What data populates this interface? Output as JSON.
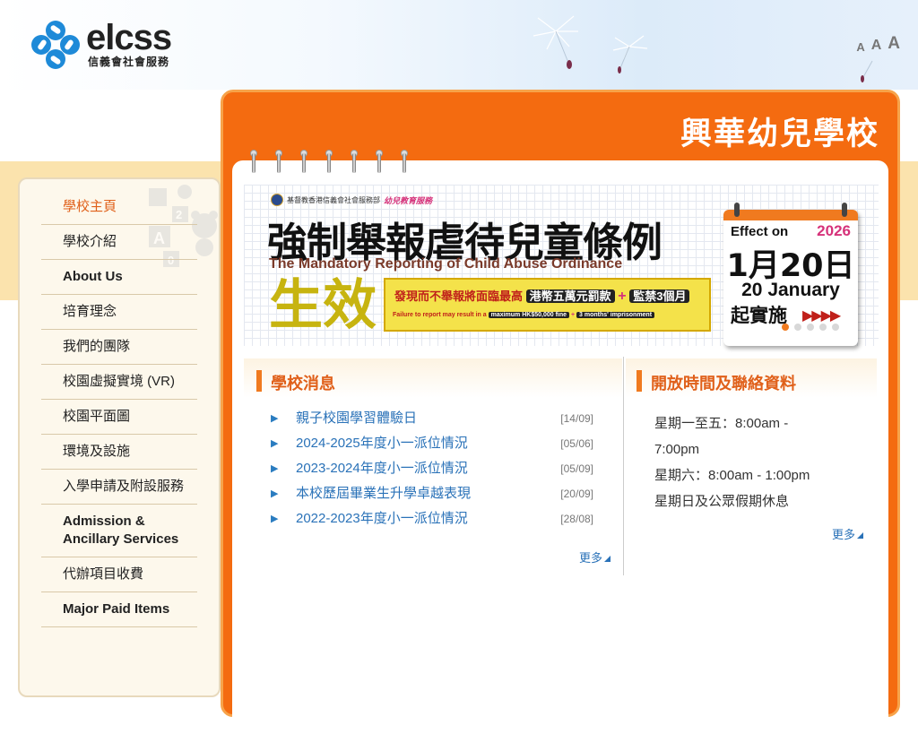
{
  "logo": {
    "brand": "elcss",
    "sub": "信義會社會服務"
  },
  "font_size_controls": [
    "A",
    "A",
    "A"
  ],
  "school_title": "興華幼兒學校",
  "banner": {
    "org": "基督教香港信義會社會服務部",
    "service": "幼兒教育服務",
    "headline_zh": "強制舉報虐待兒童條例",
    "headline_en": "The Mandatory Reporting of Child Abuse Ordinance",
    "effective_zh": "生效",
    "penalty_zh_a": "發現而不舉報將面臨最高",
    "penalty_zh_fine": "港幣五萬元罰款",
    "penalty_zh_plus": "+",
    "penalty_zh_jail": "監禁3個月",
    "penalty_en_a": "Failure to report may result in a",
    "penalty_en_fine": "maximum HK$50,000 fine",
    "penalty_en_plus": "+",
    "penalty_en_jail": "3 months' imprisonment",
    "calendar": {
      "effect_on": "Effect on",
      "year": "2026",
      "date_zh": "1月20日",
      "date_en": "20 January",
      "start_zh": "起實施",
      "arrows": "▶▶▶▶"
    },
    "slide_count": 5,
    "active_slide": 1
  },
  "sidebar": {
    "items": [
      {
        "label": "學校主頁",
        "active": true
      },
      {
        "label": "學校介紹"
      },
      {
        "label": "About Us"
      },
      {
        "label": "培育理念"
      },
      {
        "label": "我們的團隊"
      },
      {
        "label": "校園虛擬實境 (VR)"
      },
      {
        "label": "校園平面圖"
      },
      {
        "label": "環境及設施"
      },
      {
        "label": "入學申請及附設服務"
      },
      {
        "label": "Admission & Ancillary Services"
      },
      {
        "label": "代辦項目收費"
      },
      {
        "label": "Major Paid Items"
      }
    ]
  },
  "news": {
    "title": "學校消息",
    "items": [
      {
        "title": "親子校園學習體驗日",
        "date": "[14/09]"
      },
      {
        "title": "2024-2025年度小一派位情況",
        "date": "[05/06]"
      },
      {
        "title": "2023-2024年度小一派位情況",
        "date": "[05/09]"
      },
      {
        "title": "本校歷屆畢業生升學卓越表現",
        "date": "[20/09]"
      },
      {
        "title": "2022-2023年度小一派位情況",
        "date": "[28/08]"
      }
    ],
    "more": "更多"
  },
  "hours": {
    "title": "開放時間及聯絡資料",
    "lines": [
      "星期一至五：8:00am - 7:00pm",
      "星期六：8:00am - 1:00pm",
      "星期日及公眾假期休息"
    ],
    "more": "更多"
  },
  "colors": {
    "accent": "#f46b10",
    "link": "#2a72b8",
    "cream": "#fbe3ad"
  }
}
